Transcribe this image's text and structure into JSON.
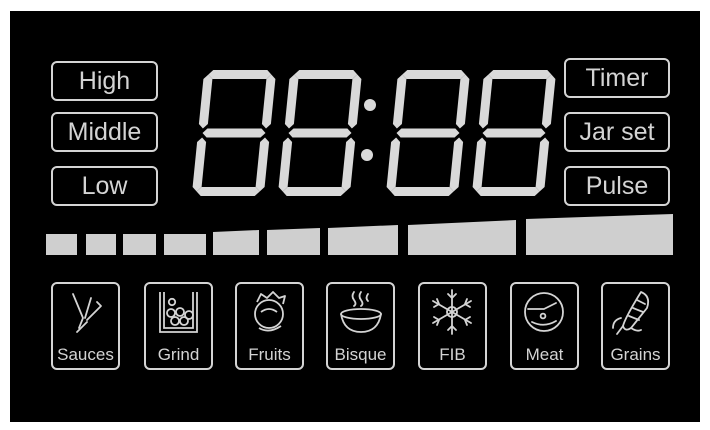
{
  "speed_buttons": {
    "high": "High",
    "middle": "Middle",
    "low": "Low"
  },
  "function_buttons": {
    "timer": "Timer",
    "jar_set": "Jar set",
    "pulse": "Pulse"
  },
  "display": {
    "digits": "88:88",
    "segment_color": "#d9d9d9"
  },
  "speed_bar_segments": 9,
  "programs": [
    {
      "label": "Sauces",
      "icon": "hand-blender-icon"
    },
    {
      "label": "Grind",
      "icon": "grinder-jar-icon"
    },
    {
      "label": "Fruits",
      "icon": "fruit-bowl-icon"
    },
    {
      "label": "Bisque",
      "icon": "soup-bowl-icon"
    },
    {
      "label": "FIB",
      "icon": "snowflake-icon"
    },
    {
      "label": "Meat",
      "icon": "meat-chop-icon"
    },
    {
      "label": "Grains",
      "icon": "corn-icon"
    }
  ],
  "colors": {
    "panel": "#000000",
    "foreground": "#d4d4d4",
    "bar": "#cfcfcf"
  }
}
